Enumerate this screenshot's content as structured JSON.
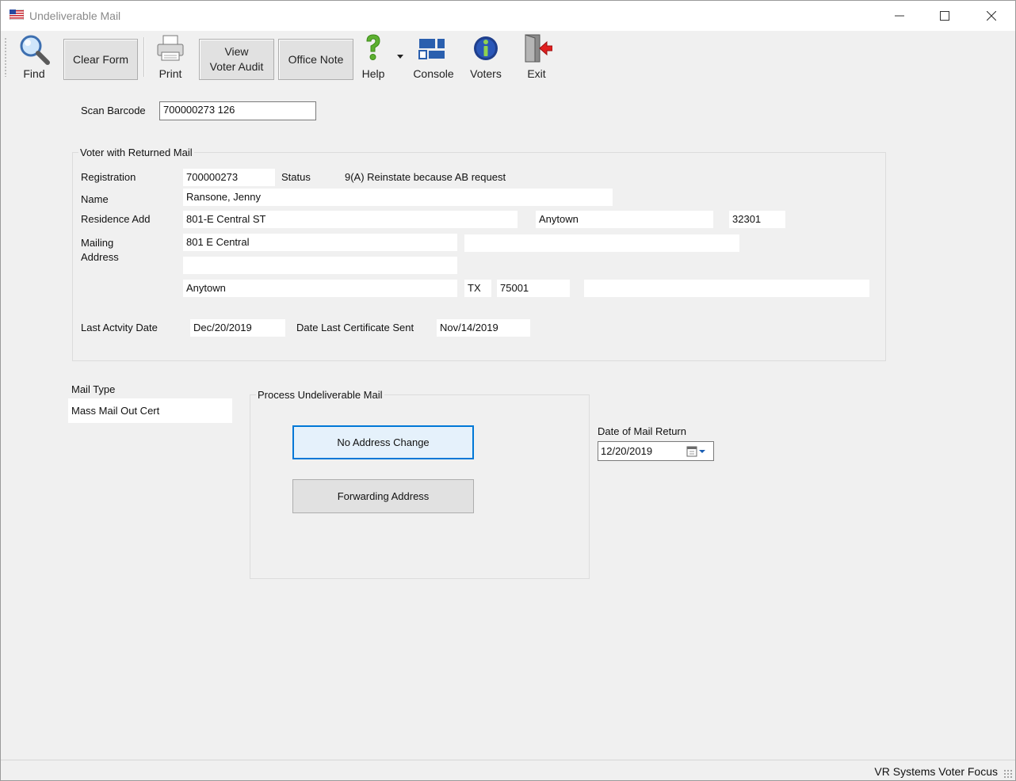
{
  "window": {
    "title": "Undeliverable Mail"
  },
  "toolbar": {
    "find": "Find",
    "clear_form": "Clear Form",
    "print": "Print",
    "view_voter_audit_line1": "View",
    "view_voter_audit_line2": "Voter Audit",
    "office_note": "Office Note",
    "help": "Help",
    "console": "Console",
    "voters": "Voters",
    "exit": "Exit"
  },
  "scan": {
    "label": "Scan Barcode",
    "value": "700000273 126"
  },
  "voter": {
    "group_title": "Voter with Returned Mail",
    "registration_label": "Registration",
    "registration": "700000273",
    "status_label": "Status",
    "status": "9(A) Reinstate because AB request",
    "name_label": "Name",
    "name": "Ransone, Jenny",
    "residence_label": "Residence Add",
    "residence_street": "801-E Central ST",
    "residence_city": "Anytown",
    "residence_zip": "32301",
    "mailing_label_line1": "Mailing",
    "mailing_label_line2": "Address",
    "mailing_line1": "801 E Central",
    "mailing_line1_extra": "",
    "mailing_line2": "",
    "mailing_city": "Anytown",
    "mailing_state": "TX",
    "mailing_zip": "75001",
    "mailing_extra": "",
    "last_activity_label": "Last Actvity Date",
    "last_activity": "Dec/20/2019",
    "last_cert_label": "Date Last Certificate Sent",
    "last_cert": "Nov/14/2019"
  },
  "mail_type": {
    "label": "Mail Type",
    "value": "Mass Mail Out Cert"
  },
  "process": {
    "group_title": "Process Undeliverable Mail",
    "no_address_change": "No Address Change",
    "forwarding_address": "Forwarding Address"
  },
  "mail_return": {
    "label": "Date of Mail Return",
    "value": "12/20/2019"
  },
  "status_bar": {
    "text": "VR Systems Voter Focus"
  },
  "colors": {
    "accent": "#0078d7",
    "background": "#f0f0f0"
  }
}
